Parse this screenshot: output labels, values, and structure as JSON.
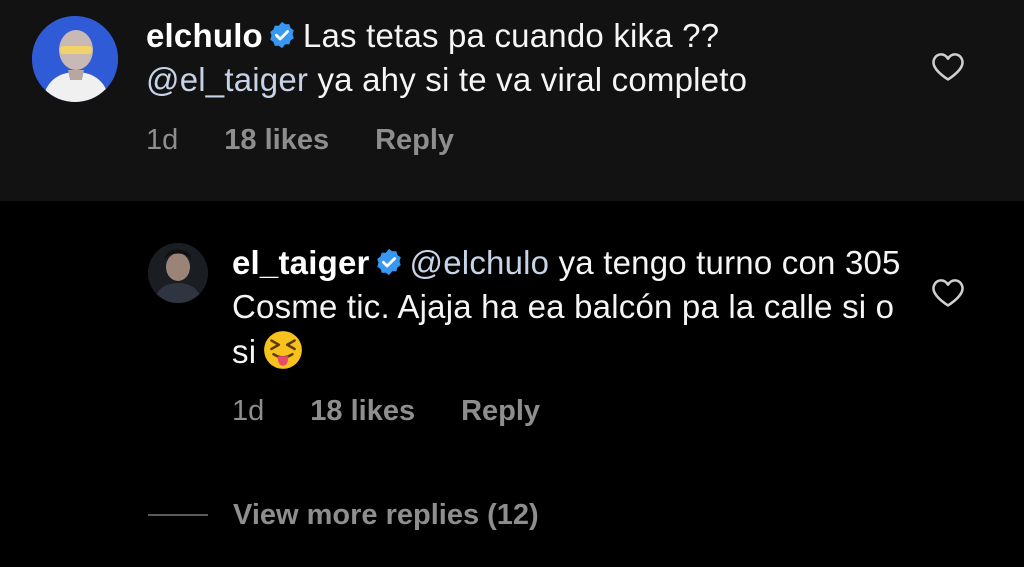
{
  "comments": [
    {
      "username": "elchulo",
      "text": "Las tetas pa cuando kika ??",
      "mention": "@el_taiger",
      "text_after": "ya ahy si te va viral completo",
      "time": "1d",
      "likes": "18 likes",
      "reply_label": "Reply"
    }
  ],
  "replies": [
    {
      "username": "el_taiger",
      "mention": "@elchulo",
      "text": "ya tengo turno con 305 Cosme tic. Ajaja ha ea balcón pa la calle si o si",
      "emoji": "squinting-face-with-tongue",
      "time": "1d",
      "likes": "18 likes",
      "reply_label": "Reply"
    }
  ],
  "view_more_label": "View more replies (12)",
  "colors": {
    "background": "#000000",
    "top_comment_bg": "#121212",
    "text": "#f5f5f5",
    "meta": "#8e8e8e",
    "verified": "#3897f0"
  }
}
